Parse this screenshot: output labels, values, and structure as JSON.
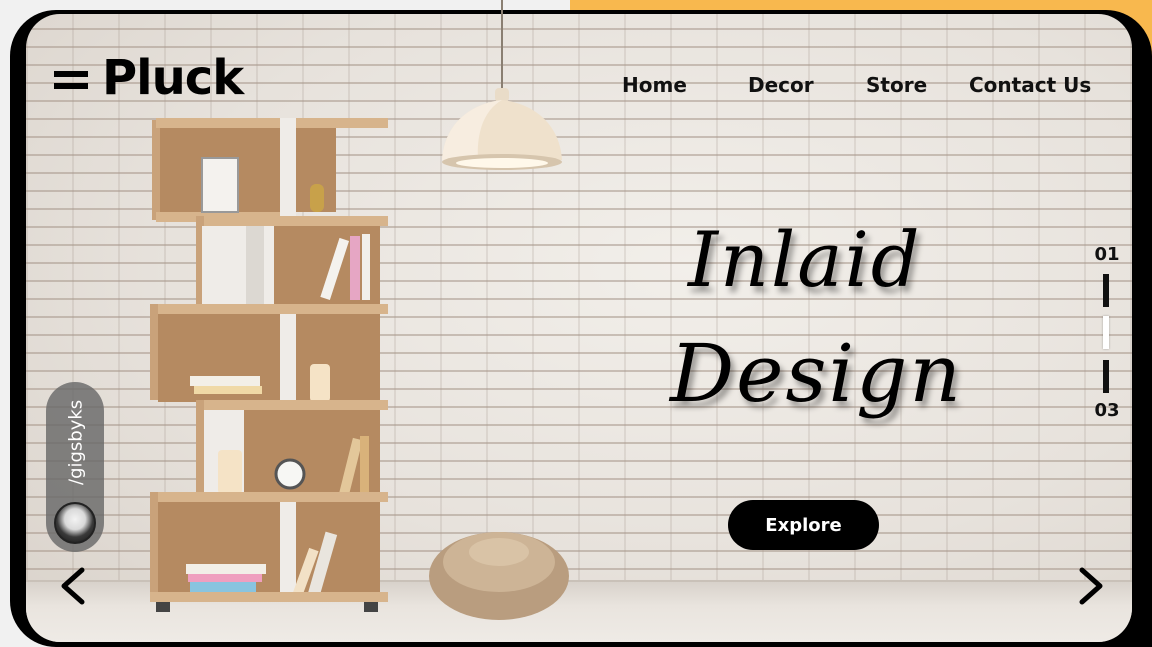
{
  "brand": {
    "logo_text": "Pluck",
    "menu_icon": "hamburger-icon"
  },
  "nav": {
    "items": [
      {
        "label": "Home"
      },
      {
        "label": "Decor"
      },
      {
        "label": "Store"
      },
      {
        "label": "Contact Us"
      }
    ]
  },
  "hero": {
    "headline_line1": "Inlaid",
    "headline_line2": "Design",
    "cta_label": "Explore"
  },
  "slider": {
    "current_label": "01",
    "total_label": "03",
    "prev_icon": "chevron-left-icon",
    "next_icon": "chevron-right-icon"
  },
  "social": {
    "handle": "/gigsbyks"
  },
  "colors": {
    "accent_orange": "#F8B84E",
    "frame": "#000000",
    "button_bg": "#000000",
    "button_text": "#FFFFFF"
  }
}
